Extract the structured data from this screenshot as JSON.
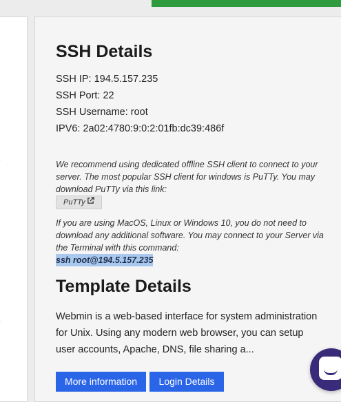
{
  "ssh": {
    "heading": "SSH Details",
    "ip_line": "SSH IP: 194.5.157.235",
    "port_line": "SSH Port: 22",
    "username_line": "SSH Username: root",
    "ipv6_line": "IPV6: 2a02:4780:9:0:2:01fb:dc39:486f",
    "recommend_note": "We recommend using dedicated offline SSH client to connect to your server. The most popular SSH client for windows is PuTTy. You may download PuTTy via this link:",
    "putty_label": "PuTTy",
    "putty_icon": "external-link-icon",
    "terminal_note": "If you are using MacOS, Linux or Windows 10, you do not need to download any additional software. You may connect to your Server via the Terminal with this command:",
    "command": "ssh root@194.5.157.235"
  },
  "template": {
    "heading": "Template Details",
    "description": "Webmin is a web-based interface for system administration for Unix. Using any modern web browser, you can setup user accounts, Apache, DNS, file sharing a...",
    "more_info_label": "More information",
    "login_details_label": "Login Details"
  },
  "chat": {
    "icon": "chat-icon"
  },
  "colors": {
    "primary_button": "#2a65e8",
    "top_banner": "#2f9b3f",
    "command_highlight": "#a9c8ee",
    "chat_bubble": "#3a2a7a"
  }
}
